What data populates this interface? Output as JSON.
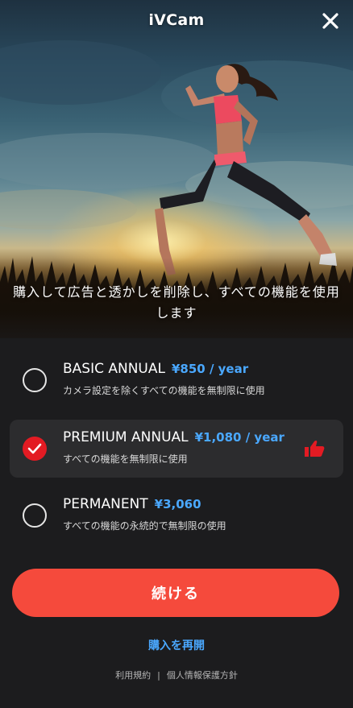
{
  "header": {
    "title": "iVCam",
    "close_icon": "close-icon"
  },
  "hero": {
    "tagline": "購入して広告と透かしを削除し、すべての機能を使用します"
  },
  "plans": [
    {
      "name": "BASIC ANNUAL",
      "price": "¥850 / year",
      "description": "カメラ設定を除くすべての機能を無制限に使用",
      "selected": false
    },
    {
      "name": "PREMIUM ANNUAL",
      "price": "¥1,080 / year",
      "description": "すべての機能を無制限に使用",
      "selected": true,
      "badge_icon": "thumbs-up-icon"
    },
    {
      "name": "PERMANENT",
      "price": "¥3,060",
      "description": "すべての機能の永続的で無制限の使用",
      "selected": false
    }
  ],
  "actions": {
    "continue_label": "続ける",
    "restore_label": "購入を再開"
  },
  "footer": {
    "terms_label": "利用規約",
    "separator": "|",
    "privacy_label": "個人情報保護方針"
  },
  "colors": {
    "accent_red": "#f54a3c",
    "checked_red": "#e31b23",
    "link_blue": "#4aa8ff",
    "background": "#1c1c1e",
    "selected_row": "#2c2c2e"
  }
}
